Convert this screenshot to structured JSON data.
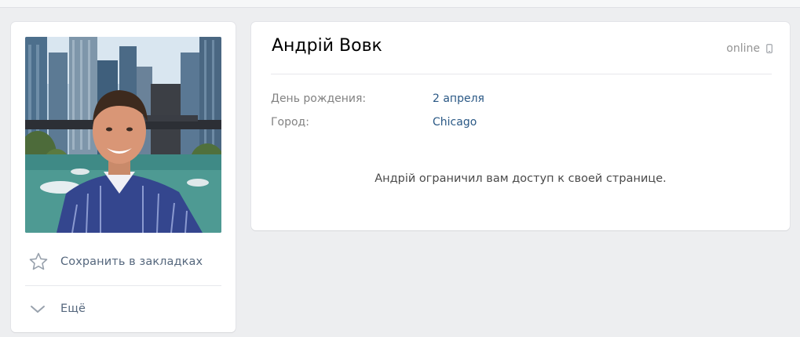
{
  "profile": {
    "name": "Андрій Вовк",
    "status": "online",
    "restricted_message": "Андрій ограничил вам доступ к своей странице."
  },
  "info": {
    "birthday_label": "День рождения:",
    "birthday_value": "2 апреля",
    "city_label": "Город:",
    "city_value": "Chicago"
  },
  "actions": {
    "save_label": "Сохранить в закладках",
    "more_label": "Ещё"
  },
  "icons": {
    "status_device": "mobile-phone-icon",
    "save": "star-icon",
    "more": "chevron-down-icon"
  },
  "colors": {
    "page_background": "#edeef0",
    "link": "#2a5885",
    "label": "#828282",
    "action_text": "#55677d"
  }
}
